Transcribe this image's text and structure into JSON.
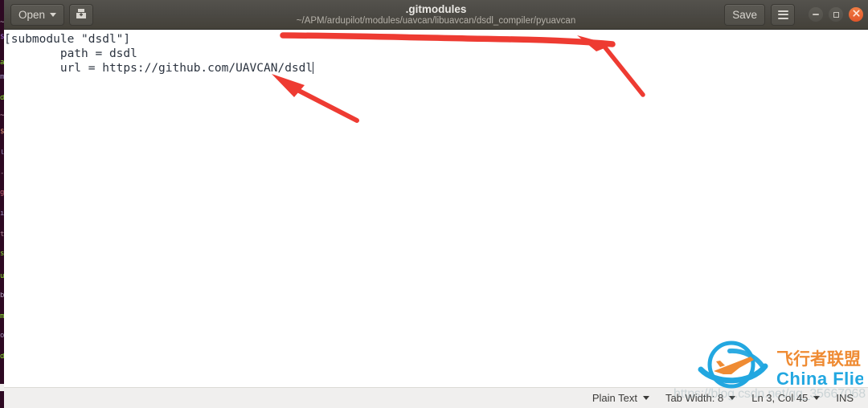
{
  "window": {
    "title": ".gitmodules",
    "subtitle": "~/APM/ardupilot/modules/uavcan/libuavcan/dsdl_compiler/pyuavcan"
  },
  "toolbar": {
    "open_label": "Open",
    "open_caret_icon": "chevron-down-icon",
    "new_doc_icon": "save-as-icon",
    "save_label": "Save",
    "menu_icon": "hamburger-menu-icon"
  },
  "window_controls": {
    "minimize_icon": "minimize-icon",
    "maximize_icon": "maximize-icon",
    "close_icon": "close-icon"
  },
  "editor": {
    "lines": [
      "[submodule \"dsdl\"]",
      "        path = dsdl",
      "        url = https://github.com/UAVCAN/dsdl"
    ],
    "full_text": "[submodule \"dsdl\"]\n        path = dsdl\n        url = https://github.com/UAVCAN/dsdl"
  },
  "statusbar": {
    "language": "Plain Text",
    "tab_width": "Tab Width: 8",
    "position": "Ln 3, Col 45",
    "insert_mode": "INS"
  },
  "annotations": {
    "arrow_1_name": "red-arrow-to-titlebar",
    "arrow_2_name": "red-arrow-to-url-line",
    "color": "#ee3b32"
  },
  "watermark": {
    "brand_cn": "飞行者联盟",
    "brand_en": "China Flier",
    "url_text": "https://blog.csdn.net/qq_35667068",
    "logo_blue": "#22a7e0",
    "logo_orange": "#ef8b33"
  },
  "background_terminal": {
    "name": "terminal-window-behind",
    "color": "#2d0922"
  }
}
